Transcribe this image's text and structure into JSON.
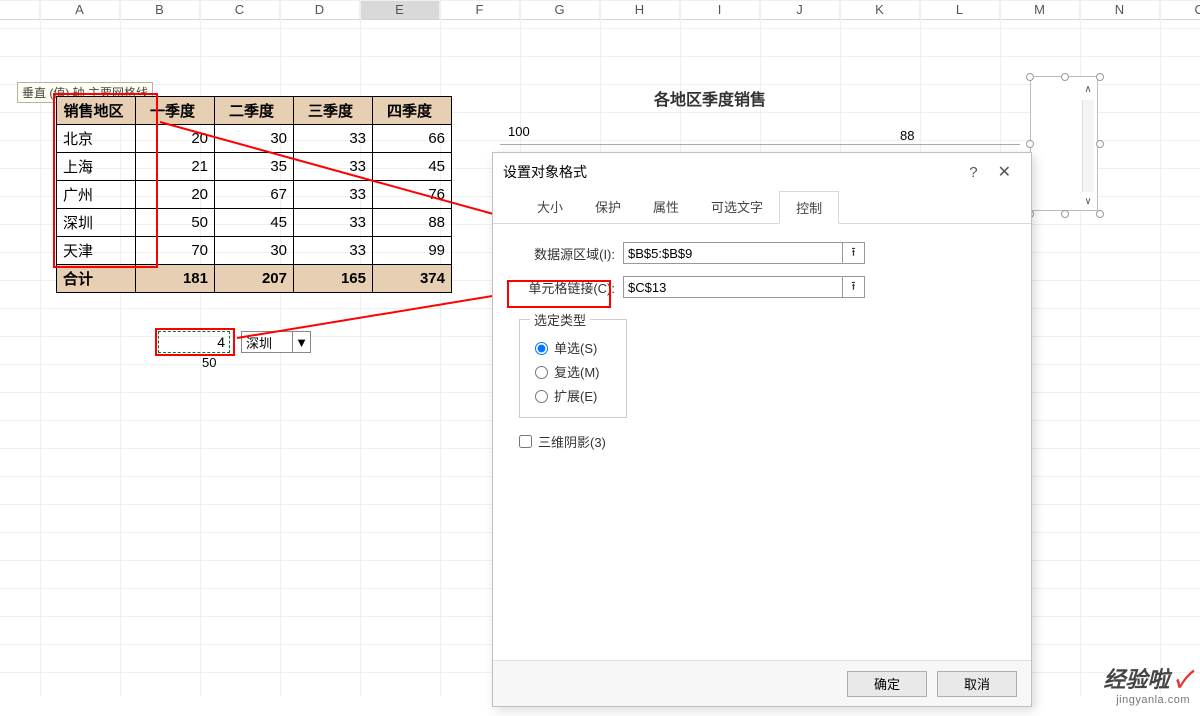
{
  "columns": [
    "A",
    "B",
    "C",
    "D",
    "E",
    "F",
    "G",
    "H",
    "I",
    "J",
    "K",
    "L",
    "M",
    "N",
    "O",
    "F"
  ],
  "tooltip": "垂直 (值) 轴 主要网格线",
  "tableHeaders": [
    "销售地区",
    "一季度",
    "二季度",
    "三季度",
    "四季度"
  ],
  "tableRows": [
    {
      "region": "北京",
      "q1": 20,
      "q2": 30,
      "q3": 33,
      "q4": 66
    },
    {
      "region": "上海",
      "q1": 21,
      "q2": 35,
      "q3": 33,
      "q4": 45
    },
    {
      "region": "广州",
      "q1": 20,
      "q2": 67,
      "q3": 33,
      "q4": 76
    },
    {
      "region": "深圳",
      "q1": 50,
      "q2": 45,
      "q3": 33,
      "q4": 88
    },
    {
      "region": "天津",
      "q1": 70,
      "q2": 30,
      "q3": 33,
      "q4": 99
    }
  ],
  "totalRow": {
    "label": "合计",
    "q1": 181,
    "q2": 207,
    "q3": 165,
    "q4": 374
  },
  "linkedCell": {
    "value": "4",
    "below": "50"
  },
  "dropdown": {
    "selected": "深圳"
  },
  "chart": {
    "title": "各地区季度销售",
    "leftVal": "100",
    "rightVal": "88"
  },
  "dialog": {
    "title": "设置对象格式",
    "tabs": [
      "大小",
      "保护",
      "属性",
      "可选文字",
      "控制"
    ],
    "activeTab": 4,
    "dataSource": {
      "label": "数据源区域(I):",
      "value": "$B$5:$B$9"
    },
    "cellLink": {
      "label": "单元格链接(C):",
      "value": "$C$13"
    },
    "selType": {
      "legend": "选定类型",
      "options": [
        "单选(S)",
        "复选(M)",
        "扩展(E)"
      ],
      "selected": 0
    },
    "shadow": "三维阴影(3)",
    "ok": "确定",
    "cancel": "取消"
  },
  "watermark": {
    "main": "经验啦",
    "sub": "jingyanla.com"
  }
}
